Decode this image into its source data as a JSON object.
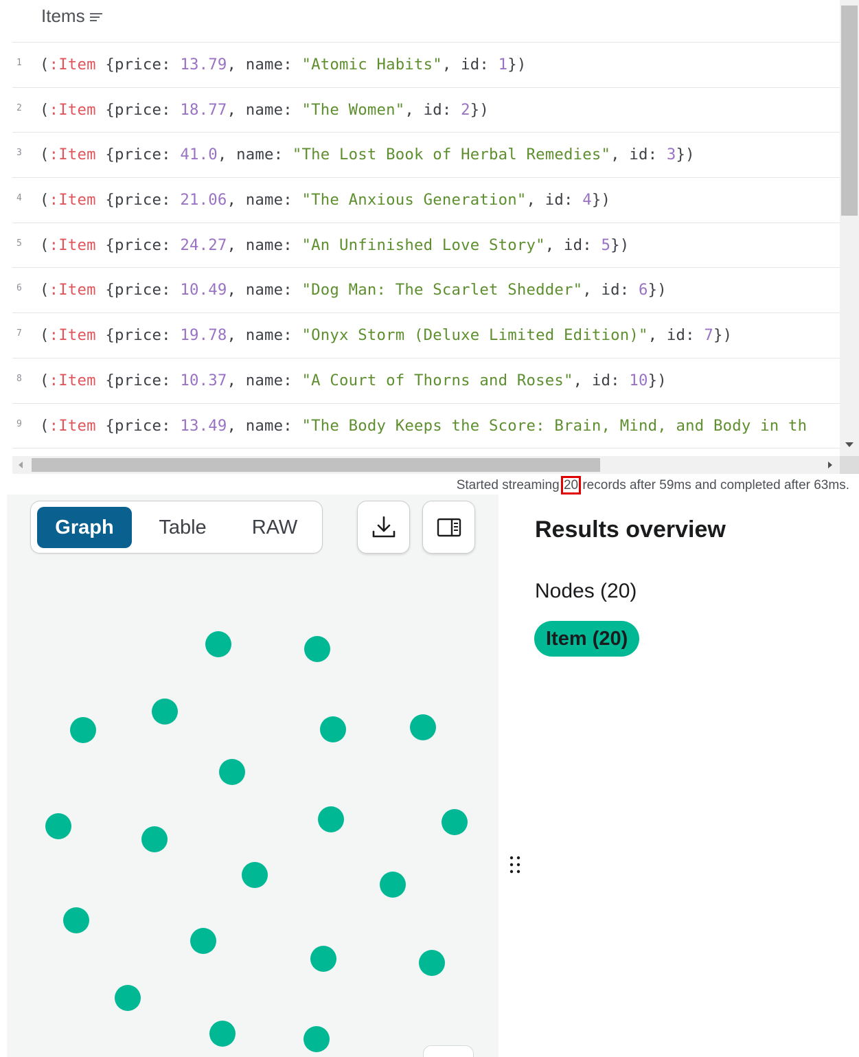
{
  "table": {
    "column_header": "Items",
    "rows": [
      {
        "idx": "1",
        "label": ":Item",
        "price": "13.79",
        "name": "\"Atomic Habits\"",
        "id": "1"
      },
      {
        "idx": "2",
        "label": ":Item",
        "price": "18.77",
        "name": "\"The Women\"",
        "id": "2"
      },
      {
        "idx": "3",
        "label": ":Item",
        "price": "41.0",
        "name": "\"The Lost Book of Herbal Remedies\"",
        "id": "3"
      },
      {
        "idx": "4",
        "label": ":Item",
        "price": "21.06",
        "name": "\"The Anxious Generation\"",
        "id": "4"
      },
      {
        "idx": "5",
        "label": ":Item",
        "price": "24.27",
        "name": "\"An Unfinished Love Story\"",
        "id": "5"
      },
      {
        "idx": "6",
        "label": ":Item",
        "price": "10.49",
        "name": "\"Dog Man: The Scarlet Shedder\"",
        "id": "6"
      },
      {
        "idx": "7",
        "label": ":Item",
        "price": "19.78",
        "name": "\"Onyx Storm (Deluxe Limited Edition)\"",
        "id": "7"
      },
      {
        "idx": "8",
        "label": ":Item",
        "price": "10.37",
        "name": "\"A Court of Thorns and Roses\"",
        "id": "10"
      },
      {
        "idx": "9",
        "label": ":Item",
        "price": "13.49",
        "name": "\"The Body Keeps the Score: Brain, Mind, and Body in th",
        "id": ""
      }
    ]
  },
  "status": {
    "prefix": "Started streaming ",
    "count": "20",
    "suffix": " records after 59ms and completed after 63ms."
  },
  "view_toggle": {
    "graph": "Graph",
    "table": "Table",
    "raw": "RAW",
    "selected": "Graph"
  },
  "toolbar": {
    "download_icon": "download-icon",
    "panel_icon": "side-panel-icon"
  },
  "overview": {
    "title": "Results overview",
    "nodes_heading": "Nodes (20)",
    "label_chip": "Item (20)"
  },
  "graph": {
    "node_count": 20,
    "node_color": "#00b894"
  },
  "colors": {
    "accent": "#0a6190",
    "node": "#00b894",
    "highlight_box": "#e00000"
  }
}
